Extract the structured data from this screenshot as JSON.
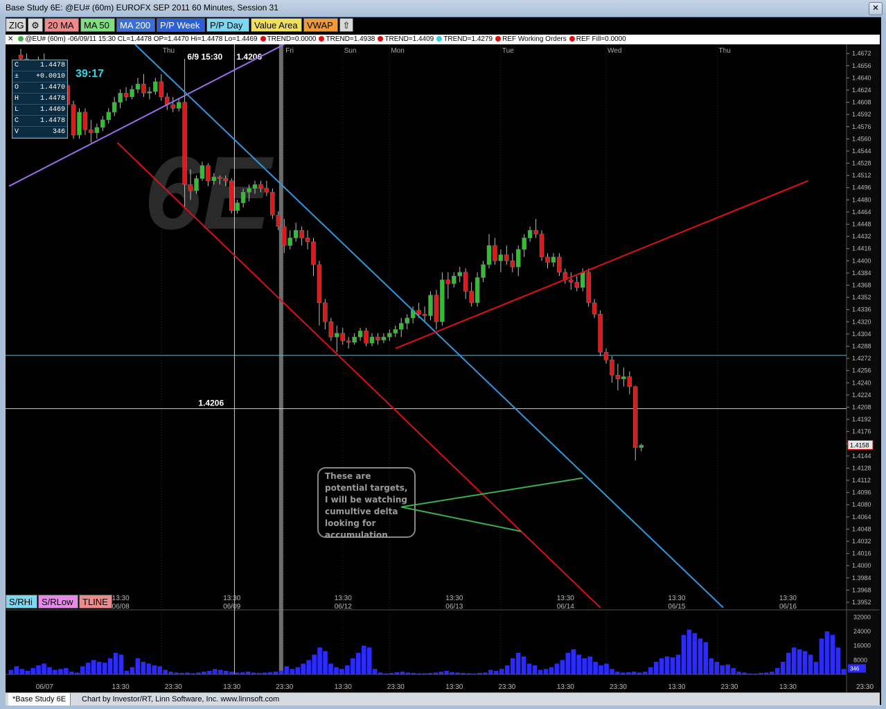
{
  "window": {
    "title": "Base Study 6E: @EU# (60m) EUROFX SEP 2011 60 Minutes, Session 31"
  },
  "toolbar": [
    {
      "label": "ZIG",
      "bg": "#d8d8d8",
      "fg": "#000000"
    },
    {
      "label": "",
      "bg": "#d8d8d8",
      "fg": "#000000",
      "icon": "gear-icon"
    },
    {
      "label": "20 MA",
      "bg": "#f08a8a",
      "fg": "#000000"
    },
    {
      "label": "MA 50",
      "bg": "#7fe07f",
      "fg": "#000000"
    },
    {
      "label": "MA 200",
      "bg": "#3b6fd6",
      "fg": "#ffffff"
    },
    {
      "label": "P/P Week",
      "bg": "#2a5fd8",
      "fg": "#ffffff"
    },
    {
      "label": "P/P Day",
      "bg": "#7ad8f0",
      "fg": "#000000"
    },
    {
      "label": "Value Area",
      "bg": "#f0e05a",
      "fg": "#000000"
    },
    {
      "label": "VWAP",
      "bg": "#f09a3a",
      "fg": "#000000"
    },
    {
      "label": "",
      "bg": "#d8d8d8",
      "fg": "#000000",
      "icon": "up-arrow-icon"
    }
  ],
  "legend": {
    "symbol": "@EU# (60m) -06/09/11 15:30 CL=1.4478 OP=1.4470 Hi=1.4478 Lo=1.4469",
    "items": [
      {
        "label": "TREND=0.0000",
        "color": "#e01010"
      },
      {
        "label": "TREND=1.4938",
        "color": "#e01010"
      },
      {
        "label": "TREND=1.4409",
        "color": "#e01010"
      },
      {
        "label": "TREND=1.4279",
        "color": "#30d0e0"
      },
      {
        "label": "REF Working Orders",
        "color": "#e01010"
      },
      {
        "label": "REF Fill=0.0000",
        "color": "#e01010"
      }
    ]
  },
  "info_box": {
    "rows": [
      {
        "k": "C",
        "v": "1.4478"
      },
      {
        "k": "±",
        "v": "+0.0010"
      },
      {
        "k": "O",
        "v": "1.4470"
      },
      {
        "k": "H",
        "v": "1.4478"
      },
      {
        "k": "L",
        "v": "1.4469"
      },
      {
        "k": "C",
        "v": "1.4478"
      },
      {
        "k": "V",
        "v": "346"
      }
    ],
    "timer": "39:17"
  },
  "study_buttons": [
    {
      "label": "S/RHi",
      "bg": "#7ad8f0"
    },
    {
      "label": "S/RLow",
      "bg": "#e58ae8"
    },
    {
      "label": "TLINE",
      "bg": "#f08a8a"
    }
  ],
  "annotation": {
    "text": "These are potential targets, I will be watching cumultive delta looking for accumulation"
  },
  "statusbar": {
    "tab": "*Base Study 6E",
    "credit": "Chart by Investor/RT, Linn Software, Inc. www.linnsoft.com"
  },
  "chart_data": [
    {
      "type": "candlestick",
      "title": "6E",
      "price_axis": {
        "ylim": [
          1.3942,
          1.4684
        ],
        "ticks": [
          1.4672,
          1.4656,
          1.464,
          1.4624,
          1.4608,
          1.4592,
          1.4576,
          1.456,
          1.4544,
          1.4528,
          1.4512,
          1.4496,
          1.448,
          1.4464,
          1.4448,
          1.4432,
          1.4416,
          1.44,
          1.4384,
          1.4368,
          1.4352,
          1.4336,
          1.432,
          1.4304,
          1.4288,
          1.4272,
          1.4256,
          1.424,
          1.4224,
          1.4208,
          1.4192,
          1.4176,
          1.416,
          1.4144,
          1.4128,
          1.4112,
          1.4096,
          1.408,
          1.4064,
          1.4048,
          1.4032,
          1.4016,
          1.4,
          1.3984,
          1.3968,
          1.3952
        ],
        "last_price": "1.4158"
      },
      "day_labels": [
        {
          "label": "Thu",
          "bar": 25
        },
        {
          "label": "Fri",
          "bar": 46
        },
        {
          "label": "Sun",
          "bar": 56
        },
        {
          "label": "Mon",
          "bar": 64
        },
        {
          "label": "Tue",
          "bar": 83
        },
        {
          "label": "Wed",
          "bar": 101
        },
        {
          "label": "Thu",
          "bar": 120
        }
      ],
      "time_labels": [
        {
          "t": "13:30",
          "d": "06/08",
          "bar": 18
        },
        {
          "t": "13:30",
          "d": "06/09",
          "bar": 37
        },
        {
          "t": "13:30",
          "d": "06/12",
          "bar": 56
        },
        {
          "t": "13:30",
          "d": "06/13",
          "bar": 75
        },
        {
          "t": "13:30",
          "d": "06/14",
          "bar": 94
        },
        {
          "t": "13:30",
          "d": "06/15",
          "bar": 113
        },
        {
          "t": "13:30",
          "d": "06/16",
          "bar": 132
        }
      ],
      "crosshair": {
        "bar": 37.5,
        "price": 1.4206,
        "label_top": "6/9 15:30",
        "label_price": "1.4206"
      },
      "hline": {
        "price": 1.4276,
        "color": "#5fb8c8"
      },
      "session_bar": 45,
      "trend_lines": [
        {
          "name": "purple-upper",
          "color": "#9b6fe8",
          "p1": [
            -1,
            1.4498
          ],
          "p2": [
            46,
            1.4684
          ]
        },
        {
          "name": "red-channel-down",
          "color": "#e01010",
          "p1": [
            17.5,
            1.4555
          ],
          "p2": [
            100,
            1.3945
          ]
        },
        {
          "name": "blue-channel-down",
          "color": "#2e9ae0",
          "p1": [
            20.5,
            1.4684
          ],
          "p2": [
            121,
            1.3945
          ]
        },
        {
          "name": "red-up",
          "color": "#e01010",
          "p1": [
            65,
            1.4285
          ],
          "p2": [
            135.5,
            1.4505
          ]
        },
        {
          "name": "target-upper",
          "color": "#3cb04a",
          "p1": [
            66,
            1.4077
          ],
          "p2": [
            97,
            1.4115
          ]
        },
        {
          "name": "target-lower",
          "color": "#3cb04a",
          "p1": [
            66,
            1.4077
          ],
          "p2": [
            86.5,
            1.4045
          ]
        }
      ],
      "bars": [
        [
          1,
          1.467,
          1.4678,
          1.466,
          1.4665
        ],
        [
          2,
          1.4665,
          1.4672,
          1.46,
          1.461
        ],
        [
          3,
          1.461,
          1.465,
          1.4608,
          1.464
        ],
        [
          4,
          1.464,
          1.4668,
          1.4635,
          1.466
        ],
        [
          5,
          1.466,
          1.4672,
          1.464,
          1.4648
        ],
        [
          6,
          1.4648,
          1.466,
          1.4625,
          1.465
        ],
        [
          7,
          1.465,
          1.4655,
          1.46,
          1.4608
        ],
        [
          8,
          1.4608,
          1.4635,
          1.4605,
          1.463
        ],
        [
          9,
          1.463,
          1.4635,
          1.46,
          1.4605
        ],
        [
          10,
          1.4605,
          1.461,
          1.456,
          1.4565
        ],
        [
          11,
          1.4565,
          1.46,
          1.456,
          1.4595
        ],
        [
          12,
          1.4595,
          1.46,
          1.4565,
          1.4572
        ],
        [
          13,
          1.4572,
          1.4585,
          1.4555,
          1.4568
        ],
        [
          14,
          1.4568,
          1.458,
          1.456,
          1.4575
        ],
        [
          15,
          1.4575,
          1.459,
          1.457,
          1.4585
        ],
        [
          16,
          1.4585,
          1.46,
          1.458,
          1.4595
        ],
        [
          17,
          1.4595,
          1.4615,
          1.459,
          1.4608
        ],
        [
          18,
          1.4608,
          1.4625,
          1.46,
          1.462
        ],
        [
          19,
          1.462,
          1.4628,
          1.461,
          1.4615
        ],
        [
          20,
          1.4615,
          1.463,
          1.4612,
          1.4625
        ],
        [
          21,
          1.4625,
          1.464,
          1.462,
          1.4632
        ],
        [
          22,
          1.4632,
          1.4645,
          1.4615,
          1.462
        ],
        [
          23,
          1.462,
          1.4628,
          1.4612,
          1.4622
        ],
        [
          24,
          1.4622,
          1.464,
          1.4618,
          1.4635
        ],
        [
          25,
          1.4635,
          1.4645,
          1.461,
          1.4615
        ],
        [
          26,
          1.4615,
          1.462,
          1.4598,
          1.4605
        ],
        [
          27,
          1.4605,
          1.4615,
          1.4595,
          1.46
        ],
        [
          28,
          1.46,
          1.4612,
          1.4596,
          1.4608
        ],
        [
          29,
          1.4608,
          1.4665,
          1.447,
          1.45
        ],
        [
          30,
          1.45,
          1.452,
          1.448,
          1.4492
        ],
        [
          31,
          1.4492,
          1.4512,
          1.4488,
          1.4508
        ],
        [
          32,
          1.4508,
          1.453,
          1.4505,
          1.4525
        ],
        [
          33,
          1.4525,
          1.4528,
          1.4498,
          1.4505
        ],
        [
          34,
          1.4505,
          1.4515,
          1.45,
          1.451
        ],
        [
          35,
          1.451,
          1.4512,
          1.45,
          1.4508
        ],
        [
          36,
          1.4508,
          1.4512,
          1.4498,
          1.4505
        ],
        [
          37,
          1.4505,
          1.4508,
          1.4462,
          1.4466
        ],
        [
          38,
          1.4466,
          1.448,
          1.4462,
          1.4476
        ],
        [
          39,
          1.4476,
          1.4495,
          1.447,
          1.449
        ],
        [
          40,
          1.449,
          1.45,
          1.4478,
          1.4495
        ],
        [
          41,
          1.4495,
          1.4505,
          1.4488,
          1.45
        ],
        [
          42,
          1.45,
          1.4505,
          1.449,
          1.4495
        ],
        [
          43,
          1.4495,
          1.4505,
          1.4485,
          1.449
        ],
        [
          44,
          1.449,
          1.4495,
          1.4455,
          1.446
        ],
        [
          45,
          1.446,
          1.4465,
          1.444,
          1.4445
        ],
        [
          46,
          1.4445,
          1.4455,
          1.441,
          1.442
        ],
        [
          47,
          1.442,
          1.444,
          1.4415,
          1.443
        ],
        [
          48,
          1.443,
          1.445,
          1.4425,
          1.444
        ],
        [
          49,
          1.444,
          1.4445,
          1.442,
          1.443
        ],
        [
          50,
          1.443,
          1.444,
          1.4415,
          1.4425
        ],
        [
          51,
          1.4425,
          1.443,
          1.438,
          1.4395
        ],
        [
          52,
          1.4395,
          1.44,
          1.4315,
          1.4345
        ],
        [
          53,
          1.4345,
          1.435,
          1.431,
          1.432
        ],
        [
          54,
          1.432,
          1.4325,
          1.4295,
          1.43
        ],
        [
          55,
          1.43,
          1.4315,
          1.428,
          1.4305
        ],
        [
          56,
          1.4305,
          1.4312,
          1.429,
          1.4295
        ],
        [
          57,
          1.4295,
          1.43,
          1.4285,
          1.4293
        ],
        [
          58,
          1.4293,
          1.4305,
          1.429,
          1.43
        ],
        [
          59,
          1.43,
          1.4312,
          1.4295,
          1.4308
        ],
        [
          60,
          1.4308,
          1.4312,
          1.4288,
          1.4292
        ],
        [
          61,
          1.4292,
          1.4305,
          1.4288,
          1.43
        ],
        [
          62,
          1.43,
          1.4305,
          1.429,
          1.4296
        ],
        [
          63,
          1.4296,
          1.4305,
          1.4292,
          1.43
        ],
        [
          64,
          1.43,
          1.431,
          1.4295,
          1.4305
        ],
        [
          65,
          1.4305,
          1.4315,
          1.43,
          1.431
        ],
        [
          66,
          1.431,
          1.4325,
          1.43,
          1.4318
        ],
        [
          67,
          1.4318,
          1.433,
          1.431,
          1.4325
        ],
        [
          68,
          1.4325,
          1.434,
          1.4318,
          1.4335
        ],
        [
          69,
          1.4335,
          1.4345,
          1.4325,
          1.433
        ],
        [
          70,
          1.433,
          1.434,
          1.432,
          1.4328
        ],
        [
          71,
          1.4328,
          1.436,
          1.4322,
          1.4355
        ],
        [
          72,
          1.4355,
          1.4362,
          1.431,
          1.432
        ],
        [
          73,
          1.432,
          1.4385,
          1.4315,
          1.4375
        ],
        [
          74,
          1.4375,
          1.4385,
          1.435,
          1.437
        ],
        [
          75,
          1.437,
          1.4385,
          1.4365,
          1.438
        ],
        [
          76,
          1.438,
          1.4392,
          1.4372,
          1.4385
        ],
        [
          77,
          1.4385,
          1.439,
          1.435,
          1.436
        ],
        [
          78,
          1.436,
          1.4372,
          1.434,
          1.4345
        ],
        [
          79,
          1.4345,
          1.4385,
          1.434,
          1.4378
        ],
        [
          80,
          1.4378,
          1.44,
          1.4372,
          1.4395
        ],
        [
          81,
          1.4395,
          1.4435,
          1.439,
          1.442
        ],
        [
          82,
          1.442,
          1.443,
          1.4395,
          1.44
        ],
        [
          83,
          1.44,
          1.4415,
          1.4385,
          1.4408
        ],
        [
          84,
          1.4408,
          1.442,
          1.4395,
          1.44
        ],
        [
          85,
          1.44,
          1.441,
          1.4385,
          1.4392
        ],
        [
          86,
          1.4392,
          1.442,
          1.438,
          1.4415
        ],
        [
          87,
          1.4415,
          1.4435,
          1.4405,
          1.443
        ],
        [
          88,
          1.443,
          1.4445,
          1.4425,
          1.444
        ],
        [
          89,
          1.444,
          1.4455,
          1.443,
          1.4435
        ],
        [
          90,
          1.4435,
          1.444,
          1.44,
          1.4405
        ],
        [
          91,
          1.4405,
          1.441,
          1.439,
          1.4398
        ],
        [
          92,
          1.4398,
          1.441,
          1.4392,
          1.4405
        ],
        [
          93,
          1.4405,
          1.441,
          1.438,
          1.4385
        ],
        [
          94,
          1.4385,
          1.439,
          1.437,
          1.4375
        ],
        [
          95,
          1.4375,
          1.4385,
          1.4362,
          1.4372
        ],
        [
          96,
          1.4372,
          1.438,
          1.436,
          1.4365
        ],
        [
          97,
          1.4365,
          1.439,
          1.436,
          1.4385
        ],
        [
          98,
          1.4385,
          1.439,
          1.434,
          1.4345
        ],
        [
          99,
          1.4345,
          1.435,
          1.4325,
          1.433
        ],
        [
          100,
          1.433,
          1.4335,
          1.4275,
          1.428
        ],
        [
          101,
          1.428,
          1.4285,
          1.4265,
          1.427
        ],
        [
          102,
          1.427,
          1.4275,
          1.424,
          1.425
        ],
        [
          103,
          1.425,
          1.4265,
          1.423,
          1.4245
        ],
        [
          104,
          1.4245,
          1.426,
          1.4235,
          1.4248
        ],
        [
          105,
          1.4248,
          1.4255,
          1.4225,
          1.4235
        ],
        [
          106,
          1.4235,
          1.4236,
          1.4138,
          1.4155
        ],
        [
          107,
          1.4155,
          1.416,
          1.415,
          1.4158
        ]
      ]
    },
    {
      "type": "bar",
      "title": "Volume",
      "ylim": [
        0,
        36000
      ],
      "ticks": [
        32000,
        24000,
        16000,
        8000
      ],
      "last_volume_label": "346",
      "values": [
        2500,
        4500,
        3000,
        2000,
        3500,
        5000,
        6000,
        4000,
        2500,
        3000,
        3500,
        1500,
        1000,
        4500,
        6500,
        8000,
        7000,
        6500,
        9000,
        12000,
        11000,
        2000,
        4000,
        9000,
        7000,
        6000,
        5000,
        4500,
        2500,
        1500,
        1000,
        800,
        1000,
        600,
        1000,
        1500,
        2000,
        3000,
        2500,
        2000,
        1500,
        1000,
        1200,
        1500,
        1000,
        800,
        1000,
        1200,
        1500,
        2000,
        4500,
        3000,
        4000,
        6000,
        8000,
        11000,
        15000,
        13000,
        6000,
        4000,
        3000,
        5000,
        9000,
        12000,
        16000,
        15000,
        3000,
        1000,
        500,
        800,
        1200,
        1500,
        1000,
        800,
        600,
        600,
        800,
        1000,
        1500,
        2000,
        1200,
        1000,
        800,
        600,
        500,
        800,
        1000,
        2500,
        2000,
        3000,
        5000,
        9000,
        12000,
        10000,
        6000,
        5000,
        2500,
        3000,
        4000,
        6000,
        8000,
        12000,
        14000,
        11000,
        9000,
        10000,
        7000,
        5000,
        6000,
        3000,
        1500,
        1000,
        1200,
        1500,
        1000,
        1500,
        4000,
        7000,
        9000,
        10000,
        9500,
        11000,
        22000,
        25000,
        23000,
        20000,
        18000,
        9000,
        7000,
        5000,
        5500,
        3500,
        1500,
        1000,
        500,
        400,
        800,
        1000,
        1500,
        3500,
        7000,
        12000,
        15000,
        14000,
        13000,
        11000,
        7000,
        20000,
        24000,
        22000,
        15000,
        3000
      ]
    }
  ]
}
